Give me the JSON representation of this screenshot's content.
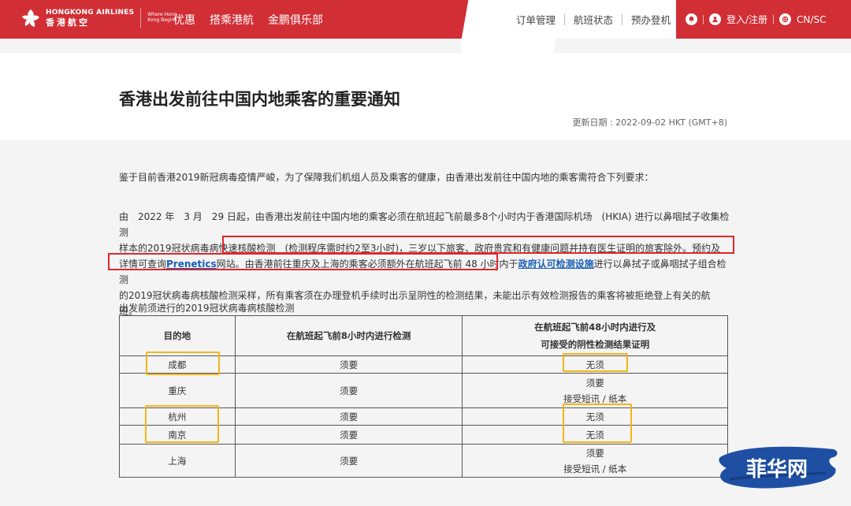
{
  "brand": {
    "name_en": "HONGKONG AIRLINES",
    "name_cn": "香港航空",
    "tagline": "Where Hong Kong Begins"
  },
  "colors": {
    "brand_red": "#d12e35",
    "link": "#1a5fb4",
    "highlight_red": "#e0262d",
    "highlight_yellow": "#f2b51b"
  },
  "nav": {
    "left": [
      "优惠",
      "搭乘港航",
      "金鹏俱乐部"
    ],
    "right": [
      "订单管理",
      "航班状态",
      "预办登机"
    ]
  },
  "utility": {
    "login": "登入/注册",
    "lang": "CN/SC"
  },
  "page": {
    "title": "香港出发前往中国内地乘客的重要通知",
    "updated": "更新日期 : 2022-09-02 HKT (GMT+8)"
  },
  "intro": "鉴于目前香港2019新冠病毒疫情严峻，为了保障我们机组人员及乘客的健康，由香港出发前往中国内地的乘客需符合下列要求：",
  "para": {
    "line1": "由　2022 年　3 月　29 日起，由香港出发前往中国内地的乘客必须在航班起飞前最多8个小时内于香港国际机场　(HKIA) 进行以鼻咽拭子收集检测",
    "line2": "样本的2019冠状病毒病快速核酸检测　(检测程序需时约2至3小时)，三岁以下旅客、政府贵宾和有健康问题并持有医生证明的旅客除外。预约及",
    "line3_pre": "详情可查询",
    "link1": "Prenetics",
    "line3_mid": "网站。由香港前往重庆及上海的乘客必须额外在航班起飞前 48 小时内于",
    "link2": "政府认可检测设施",
    "line3_post": "进行以鼻拭子或鼻咽拭子组合检测",
    "line4": "的2019冠状病毒病核酸检测采样，所有乘客须在办理登机手续时出示呈阴性的检测结果，未能出示有效检测报告的乘客将被拒绝登上有关的航",
    "line5": "班。"
  },
  "table": {
    "caption": "出发前须进行的2019冠状病毒病核酸检测",
    "headers": {
      "col1": "目的地",
      "col2": "在航班起飞前8小时内进行检测",
      "col3_a": "在航班起飞前48小时内进行及",
      "col3_b": "可接受的阴性检测结果证明"
    },
    "rows": [
      {
        "dest": "成都",
        "c2": "须要",
        "c3a": "无须",
        "c3b": ""
      },
      {
        "dest": "重庆",
        "c2": "须要",
        "c3a": "须要",
        "c3b": "接受短讯 / 纸本"
      },
      {
        "dest": "杭州",
        "c2": "须要",
        "c3a": "无须",
        "c3b": ""
      },
      {
        "dest": "南京",
        "c2": "须要",
        "c3a": "无须",
        "c3b": ""
      },
      {
        "dest": "上海",
        "c2": "须要",
        "c3a": "须要",
        "c3b": "接受短讯 / 纸本"
      }
    ]
  },
  "watermark": {
    "text": "菲华网",
    "icon": "brush-stroke-logo"
  }
}
